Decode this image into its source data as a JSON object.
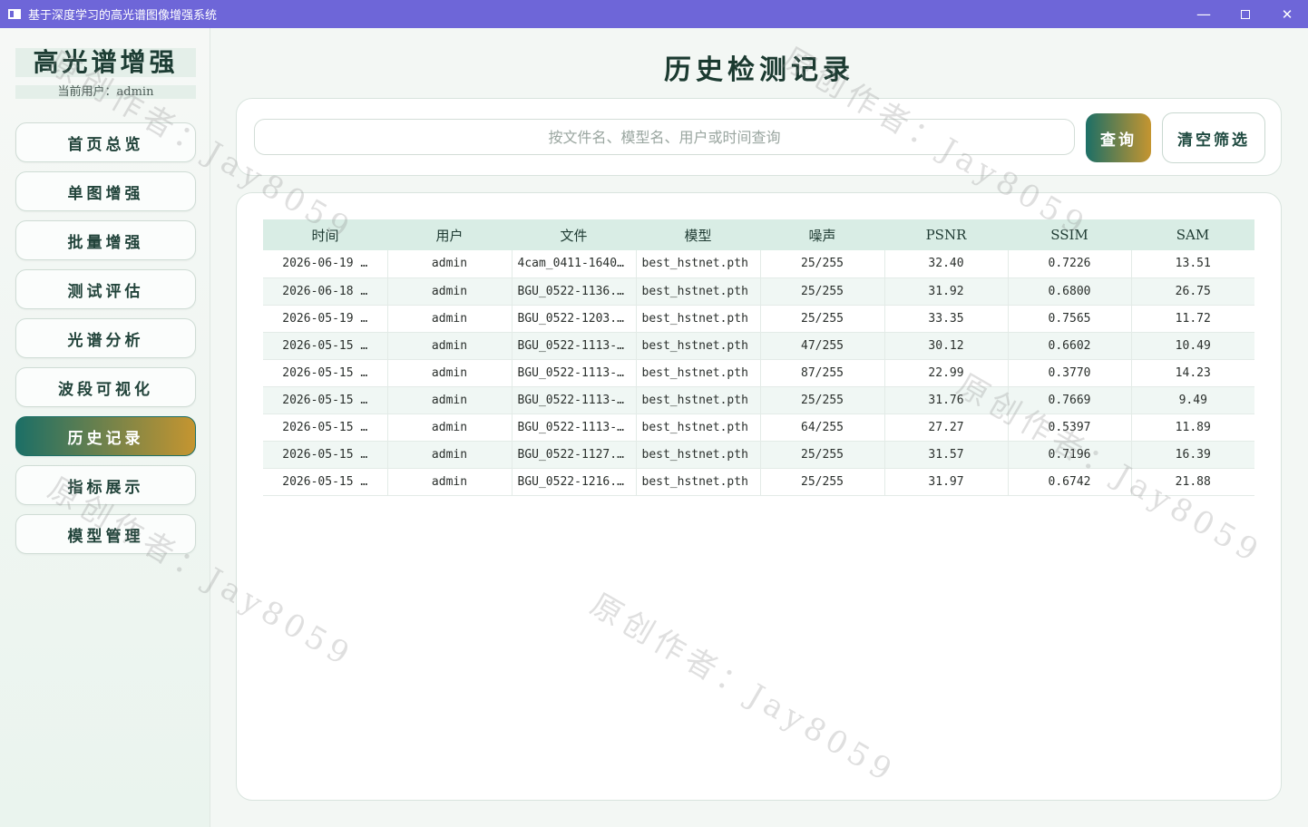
{
  "window": {
    "title": "基于深度学习的高光谱图像增强系统",
    "minimize": "—",
    "close": "✕"
  },
  "sidebar": {
    "brand": "高光谱增强",
    "current_user": "当前用户：admin",
    "items": [
      {
        "label": "首页总览",
        "active": false
      },
      {
        "label": "单图增强",
        "active": false
      },
      {
        "label": "批量增强",
        "active": false
      },
      {
        "label": "测试评估",
        "active": false
      },
      {
        "label": "光谱分析",
        "active": false
      },
      {
        "label": "波段可视化",
        "active": false
      },
      {
        "label": "历史记录",
        "active": true
      },
      {
        "label": "指标展示",
        "active": false
      },
      {
        "label": "模型管理",
        "active": false
      }
    ]
  },
  "main": {
    "title": "历史检测记录",
    "search": {
      "placeholder": "按文件名、模型名、用户或时间查询",
      "query_label": "查询",
      "clear_label": "清空筛选"
    },
    "table": {
      "columns": [
        "时间",
        "用户",
        "文件",
        "模型",
        "噪声",
        "PSNR",
        "SSIM",
        "SAM"
      ],
      "rows": [
        [
          "2026-06-19 …",
          "admin",
          "4cam_0411-1640…",
          "best_hstnet.pth",
          "25/255",
          "32.40",
          "0.7226",
          "13.51"
        ],
        [
          "2026-06-18 …",
          "admin",
          "BGU_0522-1136.…",
          "best_hstnet.pth",
          "25/255",
          "31.92",
          "0.6800",
          "26.75"
        ],
        [
          "2026-05-19 …",
          "admin",
          "BGU_0522-1203.…",
          "best_hstnet.pth",
          "25/255",
          "33.35",
          "0.7565",
          "11.72"
        ],
        [
          "2026-05-15 …",
          "admin",
          "BGU_0522-1113-…",
          "best_hstnet.pth",
          "47/255",
          "30.12",
          "0.6602",
          "10.49"
        ],
        [
          "2026-05-15 …",
          "admin",
          "BGU_0522-1113-…",
          "best_hstnet.pth",
          "87/255",
          "22.99",
          "0.3770",
          "14.23"
        ],
        [
          "2026-05-15 …",
          "admin",
          "BGU_0522-1113-…",
          "best_hstnet.pth",
          "25/255",
          "31.76",
          "0.7669",
          "9.49"
        ],
        [
          "2026-05-15 …",
          "admin",
          "BGU_0522-1113-…",
          "best_hstnet.pth",
          "64/255",
          "27.27",
          "0.5397",
          "11.89"
        ],
        [
          "2026-05-15 …",
          "admin",
          "BGU_0522-1127.…",
          "best_hstnet.pth",
          "25/255",
          "31.57",
          "0.7196",
          "16.39"
        ],
        [
          "2026-05-15 …",
          "admin",
          "BGU_0522-1216.…",
          "best_hstnet.pth",
          "25/255",
          "31.97",
          "0.6742",
          "21.88"
        ]
      ]
    }
  },
  "watermark": "原创作者：Jay8059"
}
